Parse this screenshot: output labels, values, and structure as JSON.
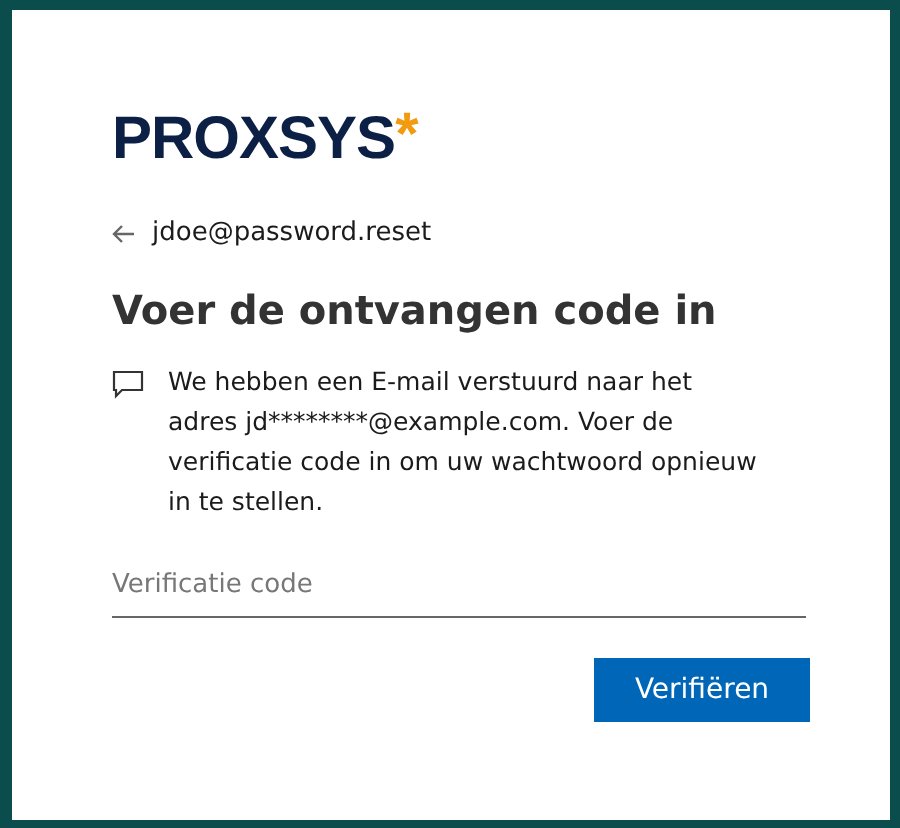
{
  "logo": {
    "name": "PROXSYS",
    "mark": "*"
  },
  "account": {
    "back_label": "jdoe@password.reset"
  },
  "heading": "Voer de ontvangen code in",
  "message": "We hebben een E-mail verstuurd naar het adres jd********@example.com. Voer de verificatie code in om uw wachtwoord opnieuw in te stellen.",
  "code_field": {
    "placeholder": "Verificatie code"
  },
  "buttons": [
    "Verifiëren"
  ]
}
